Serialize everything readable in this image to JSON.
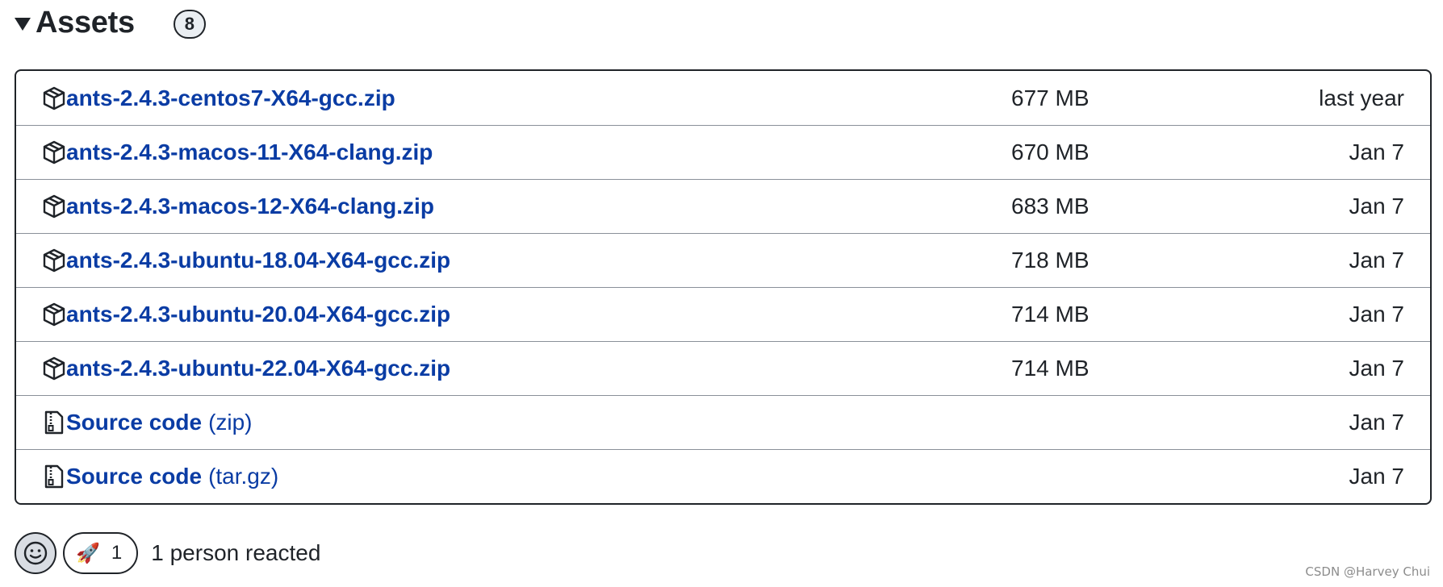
{
  "assets": {
    "title": "Assets",
    "count": "8",
    "rows": [
      {
        "name": "ants-2.4.3-centos7-X64-gcc.zip",
        "size": "677 MB",
        "date": "last year",
        "icon": "package-icon"
      },
      {
        "name": "ants-2.4.3-macos-11-X64-clang.zip",
        "size": "670 MB",
        "date": "Jan 7",
        "icon": "package-icon"
      },
      {
        "name": "ants-2.4.3-macos-12-X64-clang.zip",
        "size": "683 MB",
        "date": "Jan 7",
        "icon": "package-icon"
      },
      {
        "name": "ants-2.4.3-ubuntu-18.04-X64-gcc.zip",
        "size": "718 MB",
        "date": "Jan 7",
        "icon": "package-icon"
      },
      {
        "name": "ants-2.4.3-ubuntu-20.04-X64-gcc.zip",
        "size": "714 MB",
        "date": "Jan 7",
        "icon": "package-icon"
      },
      {
        "name": "ants-2.4.3-ubuntu-22.04-X64-gcc.zip",
        "size": "714 MB",
        "date": "Jan 7",
        "icon": "package-icon"
      },
      {
        "name": "Source code",
        "suffix": "(zip)",
        "size": "",
        "date": "Jan 7",
        "icon": "file-zip-icon"
      },
      {
        "name": "Source code",
        "suffix": "(tar.gz)",
        "size": "",
        "date": "Jan 7",
        "icon": "file-zip-icon"
      }
    ]
  },
  "reactions": {
    "emoji_button_icon": "smiley-icon",
    "rocket_emoji": "🚀",
    "rocket_count": "1",
    "summary": "1 person reacted"
  },
  "watermark": "CSDN @Harvey Chui",
  "colors": {
    "link": "#0a3ca4",
    "text": "#1f2328",
    "border": "#1f2328",
    "row_divider": "#8a9099"
  }
}
